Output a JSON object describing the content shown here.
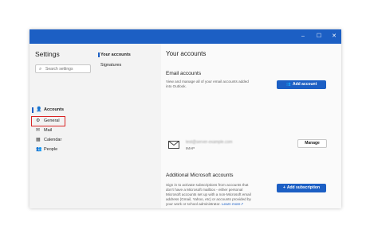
{
  "window": {
    "controls": {
      "minimize": "–",
      "maximize": "☐",
      "close": "✕"
    }
  },
  "nav": {
    "title": "Settings",
    "search_placeholder": "Search settings",
    "items": [
      {
        "label": "Accounts",
        "icon": "person-icon",
        "glyph": "👤"
      },
      {
        "label": "General",
        "icon": "gear-icon",
        "glyph": "⚙"
      },
      {
        "label": "Mail",
        "icon": "mail-icon",
        "glyph": "✉"
      },
      {
        "label": "Calendar",
        "icon": "calendar-icon",
        "glyph": "▦"
      },
      {
        "label": "People",
        "icon": "people-icon",
        "glyph": "👥"
      }
    ]
  },
  "subnav": {
    "items": [
      {
        "label": "Your accounts"
      },
      {
        "label": "Signatures"
      }
    ]
  },
  "content": {
    "title": "Your accounts",
    "email_section": {
      "title": "Email accounts",
      "desc_line1": "View and manage all of your email accounts added",
      "desc_line2": "into Outlook.",
      "add_button": "Add account",
      "account": {
        "email": "test@server-example.com",
        "type": "IMAP",
        "manage_button": "Manage"
      }
    },
    "ms_section": {
      "title": "Additional Microsoft accounts",
      "desc_lines": [
        "Sign in to activate subscriptions from accounts that",
        "don't have a Microsoft mailbox - either personal",
        "Microsoft accounts set up with a non-Microsoft email",
        "address (Gmail, Yahoo, etc) or accounts provided by"
      ],
      "desc_last": "your work or school administrator.",
      "learn_more": "Learn more",
      "add_button": "Add subscription"
    }
  },
  "colors": {
    "accent": "#1c5fc4",
    "highlight_outline": "#d92424"
  }
}
